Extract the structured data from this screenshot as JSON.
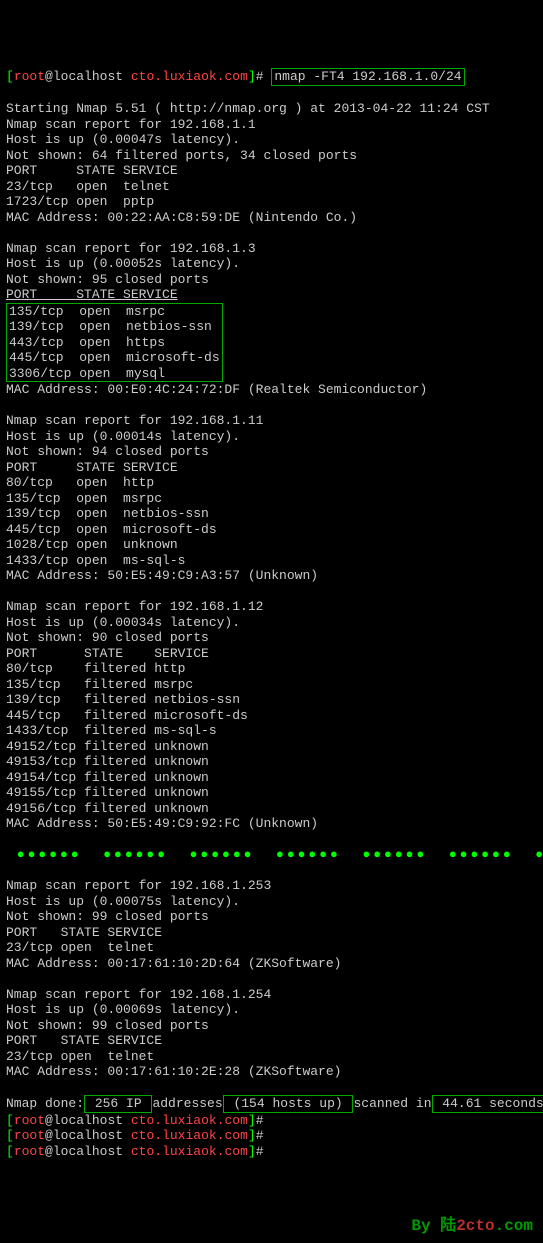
{
  "prompt": {
    "user": "root",
    "at": "@",
    "host": "localhost",
    "path": "cto.luxiaok.com",
    "hash": "#",
    "cmd": "nmap -FT4 192.168.1.0/24",
    "lb": "[",
    "rb": "]"
  },
  "header": {
    "start": "Starting Nmap 5.51 ( http://nmap.org ) at 2013-04-22 11:24 CST"
  },
  "host1": {
    "report": "Nmap scan report for 192.168.1.1",
    "up": "Host is up (0.00047s latency).",
    "notshown": "Not shown: 64 filtered ports, 34 closed ports",
    "hdr": "PORT     STATE SERVICE",
    "p1": "23/tcp   open  telnet",
    "p2": "1723/tcp open  pptp",
    "mac": "MAC Address: 00:22:AA:C8:59:DE (Nintendo Co.)"
  },
  "host2": {
    "report": "Nmap scan report for 192.168.1.3",
    "up": "Host is up (0.00052s latency).",
    "notshown": "Not shown: 95 closed ports",
    "hdr": "PORT     STATE SERVICE",
    "p1": "135/tcp  open  msrpc",
    "p2": "139/tcp  open  netbios-ssn",
    "p3": "443/tcp  open  https",
    "p4": "445/tcp  open  microsoft-ds",
    "p5": "3306/tcp open  mysql",
    "mac": "MAC Address: 00:E0:4C:24:72:DF (Realtek Semiconductor)"
  },
  "host3": {
    "report": "Nmap scan report for 192.168.1.11",
    "up": "Host is up (0.00014s latency).",
    "notshown": "Not shown: 94 closed ports",
    "hdr": "PORT     STATE SERVICE",
    "p1": "80/tcp   open  http",
    "p2": "135/tcp  open  msrpc",
    "p3": "139/tcp  open  netbios-ssn",
    "p4": "445/tcp  open  microsoft-ds",
    "p5": "1028/tcp open  unknown",
    "p6": "1433/tcp open  ms-sql-s",
    "mac": "MAC Address: 50:E5:49:C9:A3:57 (Unknown)"
  },
  "host4": {
    "report": "Nmap scan report for 192.168.1.12",
    "up": "Host is up (0.00034s latency).",
    "notshown": "Not shown: 90 closed ports",
    "hdr": "PORT      STATE    SERVICE",
    "p1": "80/tcp    filtered http",
    "p2": "135/tcp   filtered msrpc",
    "p3": "139/tcp   filtered netbios-ssn",
    "p4": "445/tcp   filtered microsoft-ds",
    "p5": "1433/tcp  filtered ms-sql-s",
    "p6": "49152/tcp filtered unknown",
    "p7": "49153/tcp filtered unknown",
    "p8": "49154/tcp filtered unknown",
    "p9": "49155/tcp filtered unknown",
    "p10": "49156/tcp filtered unknown",
    "mac": "MAC Address: 50:E5:49:C9:92:FC (Unknown)"
  },
  "ellipsis": " ●●●●●●  ●●●●●●  ●●●●●●  ●●●●●●  ●●●●●●  ●●●●●●  ●●●●●●",
  "host5": {
    "report": "Nmap scan report for 192.168.1.253",
    "up": "Host is up (0.00075s latency).",
    "notshown": "Not shown: 99 closed ports",
    "hdr": "PORT   STATE SERVICE",
    "p1": "23/tcp open  telnet",
    "mac": "MAC Address: 00:17:61:10:2D:64 (ZKSoftware)"
  },
  "host6": {
    "report": "Nmap scan report for 192.168.1.254",
    "up": "Host is up (0.00069s latency).",
    "notshown": "Not shown: 99 closed ports",
    "hdr": "PORT   STATE SERVICE",
    "p1": "23/tcp open  telnet",
    "mac": "MAC Address: 00:17:61:10:2E:28 (ZKSoftware)"
  },
  "done": {
    "pre": "Nmap done:",
    "ip": " 256 IP ",
    "mid1": "addresses",
    "up": " (154 hosts up) ",
    "mid2": "scanned in",
    "sec": " 44.61 seconds"
  },
  "watermark": {
    "by": "By 陆",
    "site": "2cto",
    "com": ".com"
  }
}
